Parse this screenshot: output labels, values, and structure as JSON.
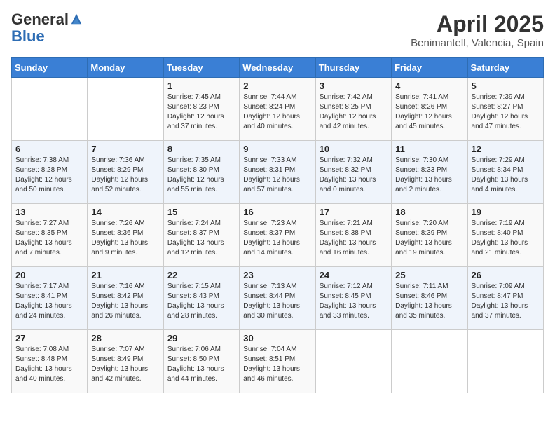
{
  "header": {
    "logo_general": "General",
    "logo_blue": "Blue",
    "title": "April 2025",
    "subtitle": "Benimantell, Valencia, Spain"
  },
  "days_of_week": [
    "Sunday",
    "Monday",
    "Tuesday",
    "Wednesday",
    "Thursday",
    "Friday",
    "Saturday"
  ],
  "weeks": [
    [
      {
        "day": "",
        "info": ""
      },
      {
        "day": "",
        "info": ""
      },
      {
        "day": "1",
        "info": "Sunrise: 7:45 AM\nSunset: 8:23 PM\nDaylight: 12 hours and 37 minutes."
      },
      {
        "day": "2",
        "info": "Sunrise: 7:44 AM\nSunset: 8:24 PM\nDaylight: 12 hours and 40 minutes."
      },
      {
        "day": "3",
        "info": "Sunrise: 7:42 AM\nSunset: 8:25 PM\nDaylight: 12 hours and 42 minutes."
      },
      {
        "day": "4",
        "info": "Sunrise: 7:41 AM\nSunset: 8:26 PM\nDaylight: 12 hours and 45 minutes."
      },
      {
        "day": "5",
        "info": "Sunrise: 7:39 AM\nSunset: 8:27 PM\nDaylight: 12 hours and 47 minutes."
      }
    ],
    [
      {
        "day": "6",
        "info": "Sunrise: 7:38 AM\nSunset: 8:28 PM\nDaylight: 12 hours and 50 minutes."
      },
      {
        "day": "7",
        "info": "Sunrise: 7:36 AM\nSunset: 8:29 PM\nDaylight: 12 hours and 52 minutes."
      },
      {
        "day": "8",
        "info": "Sunrise: 7:35 AM\nSunset: 8:30 PM\nDaylight: 12 hours and 55 minutes."
      },
      {
        "day": "9",
        "info": "Sunrise: 7:33 AM\nSunset: 8:31 PM\nDaylight: 12 hours and 57 minutes."
      },
      {
        "day": "10",
        "info": "Sunrise: 7:32 AM\nSunset: 8:32 PM\nDaylight: 13 hours and 0 minutes."
      },
      {
        "day": "11",
        "info": "Sunrise: 7:30 AM\nSunset: 8:33 PM\nDaylight: 13 hours and 2 minutes."
      },
      {
        "day": "12",
        "info": "Sunrise: 7:29 AM\nSunset: 8:34 PM\nDaylight: 13 hours and 4 minutes."
      }
    ],
    [
      {
        "day": "13",
        "info": "Sunrise: 7:27 AM\nSunset: 8:35 PM\nDaylight: 13 hours and 7 minutes."
      },
      {
        "day": "14",
        "info": "Sunrise: 7:26 AM\nSunset: 8:36 PM\nDaylight: 13 hours and 9 minutes."
      },
      {
        "day": "15",
        "info": "Sunrise: 7:24 AM\nSunset: 8:37 PM\nDaylight: 13 hours and 12 minutes."
      },
      {
        "day": "16",
        "info": "Sunrise: 7:23 AM\nSunset: 8:37 PM\nDaylight: 13 hours and 14 minutes."
      },
      {
        "day": "17",
        "info": "Sunrise: 7:21 AM\nSunset: 8:38 PM\nDaylight: 13 hours and 16 minutes."
      },
      {
        "day": "18",
        "info": "Sunrise: 7:20 AM\nSunset: 8:39 PM\nDaylight: 13 hours and 19 minutes."
      },
      {
        "day": "19",
        "info": "Sunrise: 7:19 AM\nSunset: 8:40 PM\nDaylight: 13 hours and 21 minutes."
      }
    ],
    [
      {
        "day": "20",
        "info": "Sunrise: 7:17 AM\nSunset: 8:41 PM\nDaylight: 13 hours and 24 minutes."
      },
      {
        "day": "21",
        "info": "Sunrise: 7:16 AM\nSunset: 8:42 PM\nDaylight: 13 hours and 26 minutes."
      },
      {
        "day": "22",
        "info": "Sunrise: 7:15 AM\nSunset: 8:43 PM\nDaylight: 13 hours and 28 minutes."
      },
      {
        "day": "23",
        "info": "Sunrise: 7:13 AM\nSunset: 8:44 PM\nDaylight: 13 hours and 30 minutes."
      },
      {
        "day": "24",
        "info": "Sunrise: 7:12 AM\nSunset: 8:45 PM\nDaylight: 13 hours and 33 minutes."
      },
      {
        "day": "25",
        "info": "Sunrise: 7:11 AM\nSunset: 8:46 PM\nDaylight: 13 hours and 35 minutes."
      },
      {
        "day": "26",
        "info": "Sunrise: 7:09 AM\nSunset: 8:47 PM\nDaylight: 13 hours and 37 minutes."
      }
    ],
    [
      {
        "day": "27",
        "info": "Sunrise: 7:08 AM\nSunset: 8:48 PM\nDaylight: 13 hours and 40 minutes."
      },
      {
        "day": "28",
        "info": "Sunrise: 7:07 AM\nSunset: 8:49 PM\nDaylight: 13 hours and 42 minutes."
      },
      {
        "day": "29",
        "info": "Sunrise: 7:06 AM\nSunset: 8:50 PM\nDaylight: 13 hours and 44 minutes."
      },
      {
        "day": "30",
        "info": "Sunrise: 7:04 AM\nSunset: 8:51 PM\nDaylight: 13 hours and 46 minutes."
      },
      {
        "day": "",
        "info": ""
      },
      {
        "day": "",
        "info": ""
      },
      {
        "day": "",
        "info": ""
      }
    ]
  ]
}
